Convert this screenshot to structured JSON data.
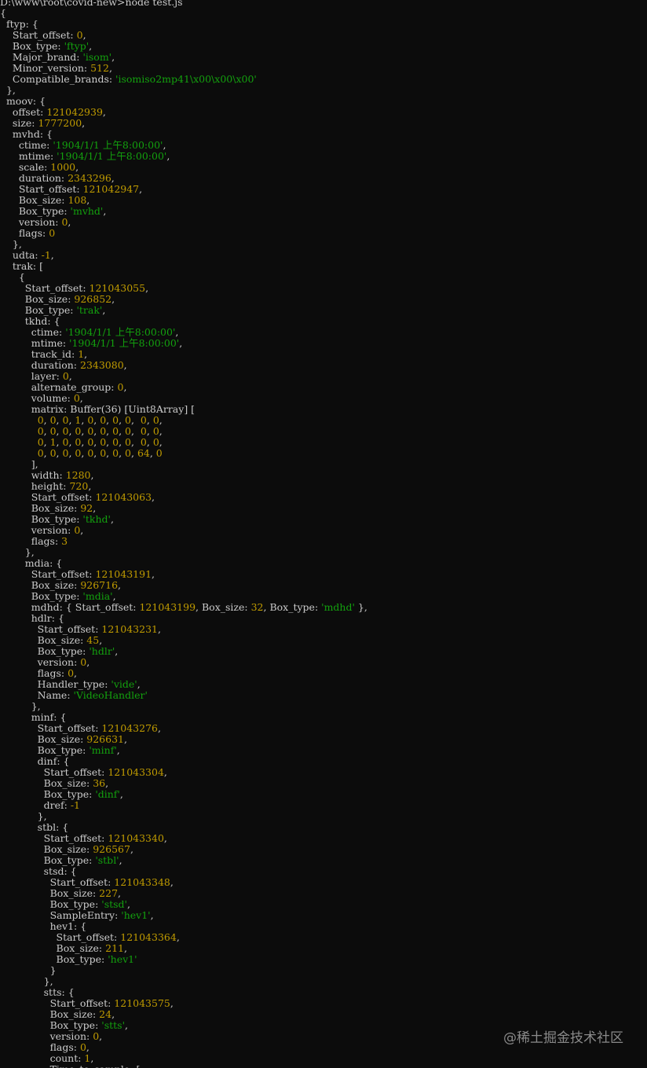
{
  "watermark": "@稀土掘金技术社区",
  "colors": {
    "background": "#0c0c0c",
    "text": "#cccccc",
    "number": "#c19c00",
    "string": "#13a10e"
  },
  "lines": [
    [
      [
        "D:\\www\\root\\covid-new>node test.js",
        "t"
      ]
    ],
    [
      [
        "{",
        "t"
      ]
    ],
    [
      [
        "  ftyp: {",
        "t"
      ]
    ],
    [
      [
        "    Start_offset: ",
        "t"
      ],
      [
        "0",
        "n"
      ],
      [
        ",",
        "t"
      ]
    ],
    [
      [
        "    Box_type: ",
        "t"
      ],
      [
        "'ftyp'",
        "s"
      ],
      [
        ",",
        "t"
      ]
    ],
    [
      [
        "    Major_brand: ",
        "t"
      ],
      [
        "'isom'",
        "s"
      ],
      [
        ",",
        "t"
      ]
    ],
    [
      [
        "    Minor_version: ",
        "t"
      ],
      [
        "512",
        "n"
      ],
      [
        ",",
        "t"
      ]
    ],
    [
      [
        "    Compatible_brands: ",
        "t"
      ],
      [
        "'isomiso2mp41\\x00\\x00\\x00'",
        "s"
      ]
    ],
    [
      [
        "  },",
        "t"
      ]
    ],
    [
      [
        "  moov: {",
        "t"
      ]
    ],
    [
      [
        "    offset: ",
        "t"
      ],
      [
        "121042939",
        "n"
      ],
      [
        ",",
        "t"
      ]
    ],
    [
      [
        "    size: ",
        "t"
      ],
      [
        "1777200",
        "n"
      ],
      [
        ",",
        "t"
      ]
    ],
    [
      [
        "    mvhd: {",
        "t"
      ]
    ],
    [
      [
        "      ctime: ",
        "t"
      ],
      [
        "'1904/1/1 上午8:00:00'",
        "s"
      ],
      [
        ",",
        "t"
      ]
    ],
    [
      [
        "      mtime: ",
        "t"
      ],
      [
        "'1904/1/1 上午8:00:00'",
        "s"
      ],
      [
        ",",
        "t"
      ]
    ],
    [
      [
        "      scale: ",
        "t"
      ],
      [
        "1000",
        "n"
      ],
      [
        ",",
        "t"
      ]
    ],
    [
      [
        "      duration: ",
        "t"
      ],
      [
        "2343296",
        "n"
      ],
      [
        ",",
        "t"
      ]
    ],
    [
      [
        "      Start_offset: ",
        "t"
      ],
      [
        "121042947",
        "n"
      ],
      [
        ",",
        "t"
      ]
    ],
    [
      [
        "      Box_size: ",
        "t"
      ],
      [
        "108",
        "n"
      ],
      [
        ",",
        "t"
      ]
    ],
    [
      [
        "      Box_type: ",
        "t"
      ],
      [
        "'mvhd'",
        "s"
      ],
      [
        ",",
        "t"
      ]
    ],
    [
      [
        "      version: ",
        "t"
      ],
      [
        "0",
        "n"
      ],
      [
        ",",
        "t"
      ]
    ],
    [
      [
        "      flags: ",
        "t"
      ],
      [
        "0",
        "n"
      ]
    ],
    [
      [
        "    },",
        "t"
      ]
    ],
    [
      [
        "    udta: ",
        "t"
      ],
      [
        "-1",
        "n"
      ],
      [
        ",",
        "t"
      ]
    ],
    [
      [
        "    trak: [",
        "t"
      ]
    ],
    [
      [
        "      {",
        "t"
      ]
    ],
    [
      [
        "        Start_offset: ",
        "t"
      ],
      [
        "121043055",
        "n"
      ],
      [
        ",",
        "t"
      ]
    ],
    [
      [
        "        Box_size: ",
        "t"
      ],
      [
        "926852",
        "n"
      ],
      [
        ",",
        "t"
      ]
    ],
    [
      [
        "        Box_type: ",
        "t"
      ],
      [
        "'trak'",
        "s"
      ],
      [
        ",",
        "t"
      ]
    ],
    [
      [
        "        tkhd: {",
        "t"
      ]
    ],
    [
      [
        "          ctime: ",
        "t"
      ],
      [
        "'1904/1/1 上午8:00:00'",
        "s"
      ],
      [
        ",",
        "t"
      ]
    ],
    [
      [
        "          mtime: ",
        "t"
      ],
      [
        "'1904/1/1 上午8:00:00'",
        "s"
      ],
      [
        ",",
        "t"
      ]
    ],
    [
      [
        "          track_id: ",
        "t"
      ],
      [
        "1",
        "n"
      ],
      [
        ",",
        "t"
      ]
    ],
    [
      [
        "          duration: ",
        "t"
      ],
      [
        "2343080",
        "n"
      ],
      [
        ",",
        "t"
      ]
    ],
    [
      [
        "          layer: ",
        "t"
      ],
      [
        "0",
        "n"
      ],
      [
        ",",
        "t"
      ]
    ],
    [
      [
        "          alternate_group: ",
        "t"
      ],
      [
        "0",
        "n"
      ],
      [
        ",",
        "t"
      ]
    ],
    [
      [
        "          volume: ",
        "t"
      ],
      [
        "0",
        "n"
      ],
      [
        ",",
        "t"
      ]
    ],
    [
      [
        "          matrix: Buffer(36) [Uint8Array] [",
        "t"
      ]
    ],
    [
      [
        "            ",
        "t"
      ],
      [
        "0",
        "n"
      ],
      [
        ", ",
        "t"
      ],
      [
        "0",
        "n"
      ],
      [
        ", ",
        "t"
      ],
      [
        "0",
        "n"
      ],
      [
        ", ",
        "t"
      ],
      [
        "1",
        "n"
      ],
      [
        ", ",
        "t"
      ],
      [
        "0",
        "n"
      ],
      [
        ", ",
        "t"
      ],
      [
        "0",
        "n"
      ],
      [
        ", ",
        "t"
      ],
      [
        "0",
        "n"
      ],
      [
        ", ",
        "t"
      ],
      [
        "0",
        "n"
      ],
      [
        ",  ",
        "t"
      ],
      [
        "0",
        "n"
      ],
      [
        ", ",
        "t"
      ],
      [
        "0",
        "n"
      ],
      [
        ",",
        "t"
      ]
    ],
    [
      [
        "            ",
        "t"
      ],
      [
        "0",
        "n"
      ],
      [
        ", ",
        "t"
      ],
      [
        "0",
        "n"
      ],
      [
        ", ",
        "t"
      ],
      [
        "0",
        "n"
      ],
      [
        ", ",
        "t"
      ],
      [
        "0",
        "n"
      ],
      [
        ", ",
        "t"
      ],
      [
        "0",
        "n"
      ],
      [
        ", ",
        "t"
      ],
      [
        "0",
        "n"
      ],
      [
        ", ",
        "t"
      ],
      [
        "0",
        "n"
      ],
      [
        ", ",
        "t"
      ],
      [
        "0",
        "n"
      ],
      [
        ",  ",
        "t"
      ],
      [
        "0",
        "n"
      ],
      [
        ", ",
        "t"
      ],
      [
        "0",
        "n"
      ],
      [
        ",",
        "t"
      ]
    ],
    [
      [
        "            ",
        "t"
      ],
      [
        "0",
        "n"
      ],
      [
        ", ",
        "t"
      ],
      [
        "1",
        "n"
      ],
      [
        ", ",
        "t"
      ],
      [
        "0",
        "n"
      ],
      [
        ", ",
        "t"
      ],
      [
        "0",
        "n"
      ],
      [
        ", ",
        "t"
      ],
      [
        "0",
        "n"
      ],
      [
        ", ",
        "t"
      ],
      [
        "0",
        "n"
      ],
      [
        ", ",
        "t"
      ],
      [
        "0",
        "n"
      ],
      [
        ", ",
        "t"
      ],
      [
        "0",
        "n"
      ],
      [
        ",  ",
        "t"
      ],
      [
        "0",
        "n"
      ],
      [
        ", ",
        "t"
      ],
      [
        "0",
        "n"
      ],
      [
        ",",
        "t"
      ]
    ],
    [
      [
        "            ",
        "t"
      ],
      [
        "0",
        "n"
      ],
      [
        ", ",
        "t"
      ],
      [
        "0",
        "n"
      ],
      [
        ", ",
        "t"
      ],
      [
        "0",
        "n"
      ],
      [
        ", ",
        "t"
      ],
      [
        "0",
        "n"
      ],
      [
        ", ",
        "t"
      ],
      [
        "0",
        "n"
      ],
      [
        ", ",
        "t"
      ],
      [
        "0",
        "n"
      ],
      [
        ", ",
        "t"
      ],
      [
        "0",
        "n"
      ],
      [
        ", ",
        "t"
      ],
      [
        "0",
        "n"
      ],
      [
        ", ",
        "t"
      ],
      [
        "64",
        "n"
      ],
      [
        ", ",
        "t"
      ],
      [
        "0",
        "n"
      ]
    ],
    [
      [
        "          ],",
        "t"
      ]
    ],
    [
      [
        "          width: ",
        "t"
      ],
      [
        "1280",
        "n"
      ],
      [
        ",",
        "t"
      ]
    ],
    [
      [
        "          height: ",
        "t"
      ],
      [
        "720",
        "n"
      ],
      [
        ",",
        "t"
      ]
    ],
    [
      [
        "          Start_offset: ",
        "t"
      ],
      [
        "121043063",
        "n"
      ],
      [
        ",",
        "t"
      ]
    ],
    [
      [
        "          Box_size: ",
        "t"
      ],
      [
        "92",
        "n"
      ],
      [
        ",",
        "t"
      ]
    ],
    [
      [
        "          Box_type: ",
        "t"
      ],
      [
        "'tkhd'",
        "s"
      ],
      [
        ",",
        "t"
      ]
    ],
    [
      [
        "          version: ",
        "t"
      ],
      [
        "0",
        "n"
      ],
      [
        ",",
        "t"
      ]
    ],
    [
      [
        "          flags: ",
        "t"
      ],
      [
        "3",
        "n"
      ]
    ],
    [
      [
        "        },",
        "t"
      ]
    ],
    [
      [
        "        mdia: {",
        "t"
      ]
    ],
    [
      [
        "          Start_offset: ",
        "t"
      ],
      [
        "121043191",
        "n"
      ],
      [
        ",",
        "t"
      ]
    ],
    [
      [
        "          Box_size: ",
        "t"
      ],
      [
        "926716",
        "n"
      ],
      [
        ",",
        "t"
      ]
    ],
    [
      [
        "          Box_type: ",
        "t"
      ],
      [
        "'mdia'",
        "s"
      ],
      [
        ",",
        "t"
      ]
    ],
    [
      [
        "          mdhd: { Start_offset: ",
        "t"
      ],
      [
        "121043199",
        "n"
      ],
      [
        ", Box_size: ",
        "t"
      ],
      [
        "32",
        "n"
      ],
      [
        ", Box_type: ",
        "t"
      ],
      [
        "'mdhd'",
        "s"
      ],
      [
        " },",
        "t"
      ]
    ],
    [
      [
        "          hdlr: {",
        "t"
      ]
    ],
    [
      [
        "            Start_offset: ",
        "t"
      ],
      [
        "121043231",
        "n"
      ],
      [
        ",",
        "t"
      ]
    ],
    [
      [
        "            Box_size: ",
        "t"
      ],
      [
        "45",
        "n"
      ],
      [
        ",",
        "t"
      ]
    ],
    [
      [
        "            Box_type: ",
        "t"
      ],
      [
        "'hdlr'",
        "s"
      ],
      [
        ",",
        "t"
      ]
    ],
    [
      [
        "            version: ",
        "t"
      ],
      [
        "0",
        "n"
      ],
      [
        ",",
        "t"
      ]
    ],
    [
      [
        "            flags: ",
        "t"
      ],
      [
        "0",
        "n"
      ],
      [
        ",",
        "t"
      ]
    ],
    [
      [
        "            Handler_type: ",
        "t"
      ],
      [
        "'vide'",
        "s"
      ],
      [
        ",",
        "t"
      ]
    ],
    [
      [
        "            Name: ",
        "t"
      ],
      [
        "'VideoHandler'",
        "s"
      ]
    ],
    [
      [
        "          },",
        "t"
      ]
    ],
    [
      [
        "          minf: {",
        "t"
      ]
    ],
    [
      [
        "            Start_offset: ",
        "t"
      ],
      [
        "121043276",
        "n"
      ],
      [
        ",",
        "t"
      ]
    ],
    [
      [
        "            Box_size: ",
        "t"
      ],
      [
        "926631",
        "n"
      ],
      [
        ",",
        "t"
      ]
    ],
    [
      [
        "            Box_type: ",
        "t"
      ],
      [
        "'minf'",
        "s"
      ],
      [
        ",",
        "t"
      ]
    ],
    [
      [
        "            dinf: {",
        "t"
      ]
    ],
    [
      [
        "              Start_offset: ",
        "t"
      ],
      [
        "121043304",
        "n"
      ],
      [
        ",",
        "t"
      ]
    ],
    [
      [
        "              Box_size: ",
        "t"
      ],
      [
        "36",
        "n"
      ],
      [
        ",",
        "t"
      ]
    ],
    [
      [
        "              Box_type: ",
        "t"
      ],
      [
        "'dinf'",
        "s"
      ],
      [
        ",",
        "t"
      ]
    ],
    [
      [
        "              dref: ",
        "t"
      ],
      [
        "-1",
        "n"
      ]
    ],
    [
      [
        "            },",
        "t"
      ]
    ],
    [
      [
        "            stbl: {",
        "t"
      ]
    ],
    [
      [
        "              Start_offset: ",
        "t"
      ],
      [
        "121043340",
        "n"
      ],
      [
        ",",
        "t"
      ]
    ],
    [
      [
        "              Box_size: ",
        "t"
      ],
      [
        "926567",
        "n"
      ],
      [
        ",",
        "t"
      ]
    ],
    [
      [
        "              Box_type: ",
        "t"
      ],
      [
        "'stbl'",
        "s"
      ],
      [
        ",",
        "t"
      ]
    ],
    [
      [
        "              stsd: {",
        "t"
      ]
    ],
    [
      [
        "                Start_offset: ",
        "t"
      ],
      [
        "121043348",
        "n"
      ],
      [
        ",",
        "t"
      ]
    ],
    [
      [
        "                Box_size: ",
        "t"
      ],
      [
        "227",
        "n"
      ],
      [
        ",",
        "t"
      ]
    ],
    [
      [
        "                Box_type: ",
        "t"
      ],
      [
        "'stsd'",
        "s"
      ],
      [
        ",",
        "t"
      ]
    ],
    [
      [
        "                SampleEntry: ",
        "t"
      ],
      [
        "'hev1'",
        "s"
      ],
      [
        ",",
        "t"
      ]
    ],
    [
      [
        "                hev1: {",
        "t"
      ]
    ],
    [
      [
        "                  Start_offset: ",
        "t"
      ],
      [
        "121043364",
        "n"
      ],
      [
        ",",
        "t"
      ]
    ],
    [
      [
        "                  Box_size: ",
        "t"
      ],
      [
        "211",
        "n"
      ],
      [
        ",",
        "t"
      ]
    ],
    [
      [
        "                  Box_type: ",
        "t"
      ],
      [
        "'hev1'",
        "s"
      ]
    ],
    [
      [
        "                }",
        "t"
      ]
    ],
    [
      [
        "              },",
        "t"
      ]
    ],
    [
      [
        "              stts: {",
        "t"
      ]
    ],
    [
      [
        "                Start_offset: ",
        "t"
      ],
      [
        "121043575",
        "n"
      ],
      [
        ",",
        "t"
      ]
    ],
    [
      [
        "                Box_size: ",
        "t"
      ],
      [
        "24",
        "n"
      ],
      [
        ",",
        "t"
      ]
    ],
    [
      [
        "                Box_type: ",
        "t"
      ],
      [
        "'stts'",
        "s"
      ],
      [
        ",",
        "t"
      ]
    ],
    [
      [
        "                version: ",
        "t"
      ],
      [
        "0",
        "n"
      ],
      [
        ",",
        "t"
      ]
    ],
    [
      [
        "                flags: ",
        "t"
      ],
      [
        "0",
        "n"
      ],
      [
        ",",
        "t"
      ]
    ],
    [
      [
        "                count: ",
        "t"
      ],
      [
        "1",
        "n"
      ],
      [
        ",",
        "t"
      ]
    ],
    [
      [
        "                Time_to_sample: [",
        "t"
      ]
    ]
  ]
}
